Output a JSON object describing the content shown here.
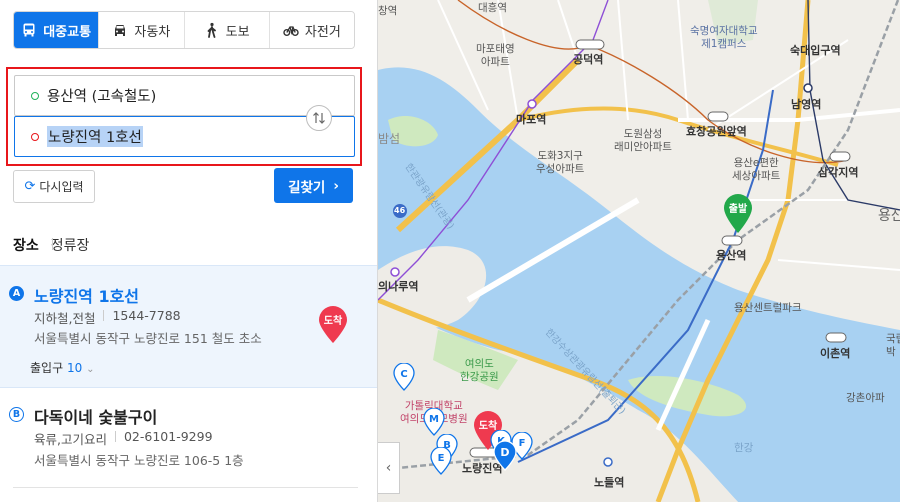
{
  "modes": [
    {
      "label": "대중교통",
      "icon": "bus-icon",
      "active": true
    },
    {
      "label": "자동차",
      "icon": "car-icon",
      "active": false
    },
    {
      "label": "도보",
      "icon": "walk-icon",
      "active": false
    },
    {
      "label": "자전거",
      "icon": "bicycle-icon",
      "active": false
    }
  ],
  "route": {
    "from": "용산역 (고속철도)",
    "to": "노량진역 1호선",
    "swap_icon": "swap-icon"
  },
  "actions": {
    "reset_label": "다시입력",
    "search_label": "길찾기"
  },
  "tabs": [
    {
      "label": "장소",
      "active": true
    },
    {
      "label": "정류장",
      "active": false
    }
  ],
  "results": [
    {
      "badge": "A",
      "title": "노량진역 1호선",
      "category": "지하철,전철",
      "phone": "1544-7788",
      "address": "서울특별시 동작구 노량진로 151 철도 초소",
      "exit_label": "출입구",
      "exit_count": "10",
      "pin_label": "도착"
    },
    {
      "badge": "B",
      "title": "다독이네 숯불구이",
      "category": "육류,고기요리",
      "phone": "02-6101-9299",
      "address": "서울특별시 동작구 노량진로 106-5 1층"
    }
  ],
  "map": {
    "labels": {
      "daeheung": "대흥역",
      "mapo_taeyoung": "마포태영\n아파트",
      "gongdeok": "공덕역",
      "sookmyung": "숙명여자대학교\n제1캠퍼스",
      "sookdae": "숙대입구역",
      "namyeong": "남영역",
      "mapo": "마포역",
      "dowon": "도원삼성\n래미안아파트",
      "hyochang": "효창공원앞역",
      "dohwa": "도화3지구\n우성아파트",
      "yongsan_e": "용산e편한\n세상아파트",
      "samgakji": "삼각지역",
      "yongsan": "용산역",
      "yongsan_central": "용산센트럴파크",
      "ichon": "이촌역",
      "yeouinaru": "의나루역",
      "yeouido_park": "여의도\n한강공원",
      "catholic": "가톨릭대학교\n여의도성모병원",
      "noryangjin": "노량진역",
      "nodeul": "노들역",
      "hangang": "한강",
      "gangchon": "강촌아파",
      "yongsan_short": "용산",
      "bamseom": "밤섬",
      "gungnip": "국립\n박",
      "changyeok": "창역",
      "gangbyeon1": "한관광유람선(관광)",
      "gangbyeon2": "한강수상관광유람선(출퇴근)",
      "route46": "46"
    },
    "depart_pin": "출발",
    "arrive_pin": "도착",
    "markers": [
      "C",
      "M",
      "B",
      "K",
      "F",
      "E",
      "D"
    ],
    "collapse_icon": "chevron-left-icon"
  }
}
